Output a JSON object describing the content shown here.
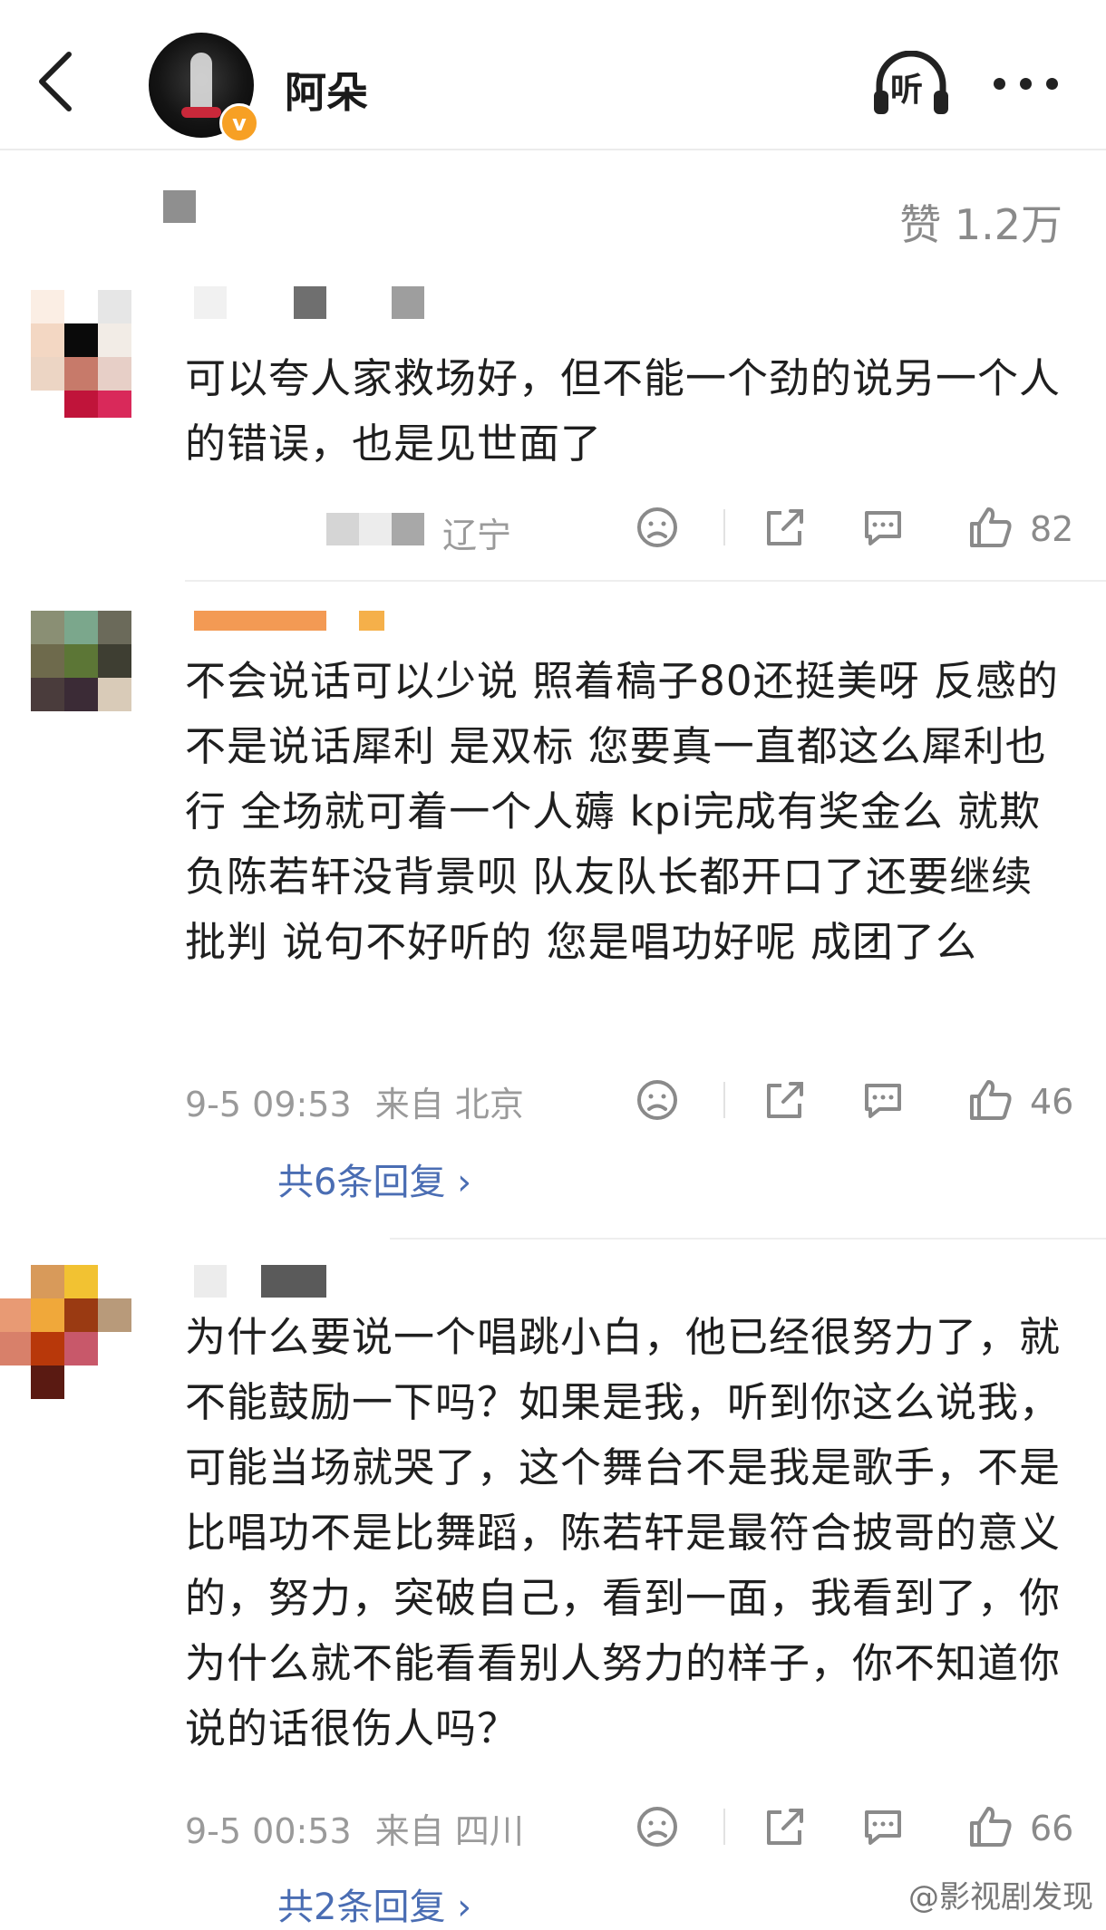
{
  "header": {
    "author_name": "阿朵",
    "listen_label": "听"
  },
  "likes": {
    "label": "赞 1.2万"
  },
  "comments": [
    {
      "username": "",
      "text": "可以夸人家救场好，但不能一个劲的说另一个人的错误，也是见世面了",
      "time": "",
      "from": "辽宁",
      "likes": "82"
    },
    {
      "username": "",
      "text": "不会说话可以少说 照着稿子80还挺美呀 反感的不是说话犀利 是双标 您要真一直都这么犀利也行 全场就可着一个人薅 kpi完成有奖金么 就欺负陈若轩没背景呗 队友队长都开口了还要继续批判 说句不好听的 您是唱功好呢 成团了么",
      "time": "9-5 09:53",
      "from": "来自 北京",
      "likes": "46",
      "replies": "共6条回复 ›"
    },
    {
      "username": "",
      "text": "为什么要说一个唱跳小白，他已经很努力了，就不能鼓励一下吗？如果是我，听到你这么说我，可能当场就哭了，这个舞台不是我是歌手，不是比唱功不是比舞蹈，陈若轩是最符合披哥的意义的，努力，突破自己，看到一面，我看到了，你为什么就不能看看别人努力的样子，你不知道你说的话很伤人吗？",
      "time": "9-5 00:53",
      "from": "来自 四川",
      "likes": "66",
      "replies": "共2条回复 ›"
    }
  ],
  "watermark": "@影视剧发现",
  "colors": {
    "link": "#4a6db3",
    "meta": "#9a9a9a",
    "verified": "#f7a024",
    "username": "#e0862c"
  },
  "icons": [
    "back-arrow-icon",
    "headphones-icon",
    "more-icon",
    "dislike-icon",
    "share-icon",
    "comment-icon",
    "like-icon"
  ]
}
